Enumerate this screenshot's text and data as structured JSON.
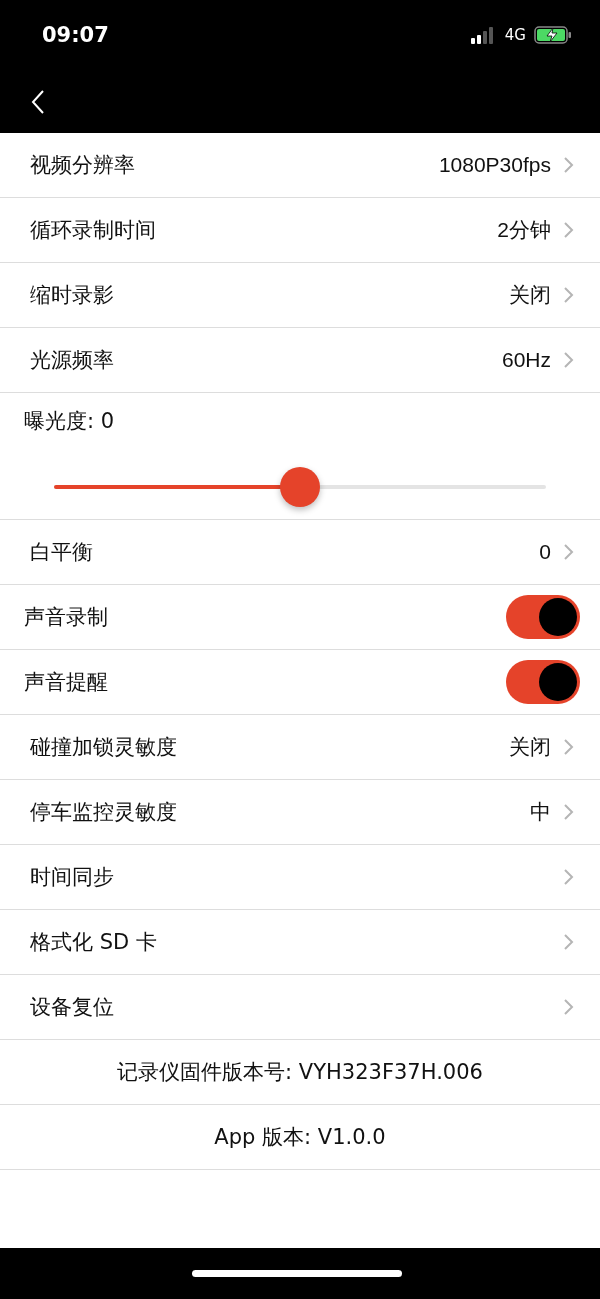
{
  "status_bar": {
    "time": "09:07",
    "network": "4G"
  },
  "rows": [
    {
      "kind": "nav",
      "label": "视频分辨率",
      "value": "1080P30fps"
    },
    {
      "kind": "nav",
      "label": "循环录制时间",
      "value": "2分钟"
    },
    {
      "kind": "nav",
      "label": "缩时录影",
      "value": "关闭"
    },
    {
      "kind": "nav",
      "label": "光源频率",
      "value": "60Hz"
    },
    {
      "kind": "slider",
      "label": "曝光度: 0",
      "level": 0.5
    },
    {
      "kind": "nav",
      "label": "白平衡",
      "value": "0"
    },
    {
      "kind": "toggle",
      "label": "声音录制",
      "on": true
    },
    {
      "kind": "toggle",
      "label": "声音提醒",
      "on": true
    },
    {
      "kind": "nav",
      "label": "碰撞加锁灵敏度",
      "value": "关闭"
    },
    {
      "kind": "nav",
      "label": "停车监控灵敏度",
      "value": "中"
    },
    {
      "kind": "nav",
      "label": "时间同步"
    },
    {
      "kind": "nav",
      "label": "格式化 SD 卡"
    },
    {
      "kind": "nav",
      "label": "设备复位"
    },
    {
      "kind": "info",
      "label": "记录仪固件版本号: VYH323F37H.006"
    },
    {
      "kind": "info",
      "label": "App 版本: V1.0.0"
    }
  ]
}
